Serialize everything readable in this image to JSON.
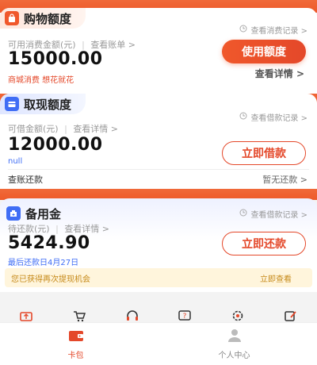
{
  "colors": {
    "accent": "#e4482a",
    "blue": "#3f6df5",
    "muted": "#999999",
    "notice_text": "#c68a1a"
  },
  "shopping": {
    "title": "购物额度",
    "record_link": "查看消费记录 >",
    "available_label": "可用消费金额(元)",
    "bill_link": "查看账单 >",
    "amount": "15000.00",
    "note": "商城消费 想花就花",
    "button": "使用额度",
    "detail_link": "查看详情 >"
  },
  "cash": {
    "title": "取现额度",
    "record_link": "查看借款记录 >",
    "available_label": "可借金额(元)",
    "detail_link": "查看详情 >",
    "amount": "12000.00",
    "note": "null",
    "button": "立即借款",
    "repay_label": "查账还款",
    "repay_status": "暂无还款 >"
  },
  "reserve": {
    "title": "备用金",
    "record_link": "查看借款记录 >",
    "due_label": "待还款(元)",
    "detail_link": "查看详情 >",
    "amount": "5424.90",
    "last_repay": "最后还款日4月27日",
    "button": "立即还款"
  },
  "notice": {
    "text": "您已获得再次提现机会",
    "action": "立即查看"
  },
  "quick_icons": [
    "wallet-icon",
    "cart-icon",
    "headset-icon",
    "help-icon",
    "settings-icon",
    "edit-icon"
  ],
  "tabs": [
    {
      "label": "卡包",
      "icon": "wallet-icon",
      "active": true
    },
    {
      "label": "个人中心",
      "icon": "person-icon",
      "active": false
    }
  ]
}
